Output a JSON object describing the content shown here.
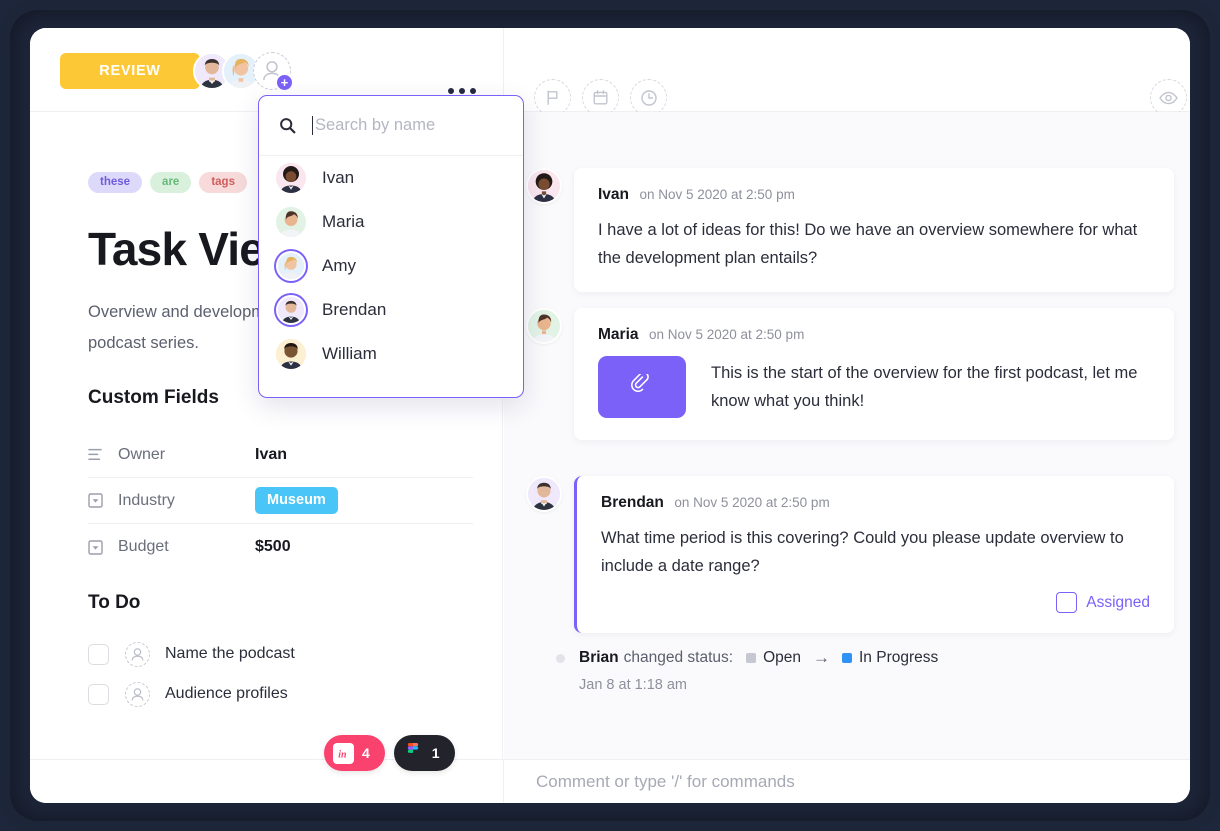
{
  "header": {
    "status_button": "REVIEW",
    "assignee_avatars": [
      "Brendan",
      "Amy"
    ],
    "add_assignee_icon": "add-person-icon",
    "more_icon": "ellipsis-icon",
    "tool_icons": [
      "flag-icon",
      "calendar-icon",
      "clock-icon"
    ],
    "watch_icon": "eye-icon"
  },
  "assignee_dropdown": {
    "search_icon": "search-icon",
    "search_value": "",
    "search_placeholder": "Search by name",
    "people": [
      {
        "name": "Ivan",
        "selected": false,
        "avatar_bg": "#fae6ef"
      },
      {
        "name": "Maria",
        "selected": false,
        "avatar_bg": "#e2f3e6"
      },
      {
        "name": "Amy",
        "selected": true,
        "avatar_bg": "#e4f1fb"
      },
      {
        "name": "Brendan",
        "selected": true,
        "avatar_bg": "#efe9fb"
      },
      {
        "name": "William",
        "selected": false,
        "avatar_bg": "#fcefd2"
      }
    ]
  },
  "task": {
    "tags": [
      {
        "label": "these",
        "bg": "#ddd9fa",
        "color": "#6f5cdb"
      },
      {
        "label": "are",
        "bg": "#d8f0dc",
        "color": "#67b978"
      },
      {
        "label": "tags",
        "bg": "#f7dad9",
        "color": "#cf5c5c"
      }
    ],
    "title": "Task View",
    "description": "Overview and development plan for the original podcast series.",
    "custom_fields_heading": "Custom Fields",
    "fields": [
      {
        "icon": "list-icon",
        "label": "Owner",
        "value": "Ivan",
        "type": "text"
      },
      {
        "icon": "dropdown-icon",
        "label": "Industry",
        "value": "Museum",
        "type": "chip",
        "chip_color": "#49c6f7"
      },
      {
        "icon": "dropdown-icon",
        "label": "Budget",
        "value": "$500",
        "type": "text"
      }
    ],
    "todo_heading": "To Do",
    "todo_items": [
      {
        "label": "Name the podcast",
        "checked": false,
        "assignee_icon": "user-placeholder-icon"
      },
      {
        "label": "Audience profiles",
        "checked": false,
        "assignee_icon": "user-placeholder-icon"
      }
    ]
  },
  "activity": {
    "comments": [
      {
        "author": "Ivan",
        "timestamp": "on Nov 5 2020 at 2:50 pm",
        "body": "I have a lot of ideas for this! Do we have an overview somewhere for what the development plan entails?",
        "has_attachment": false,
        "accent": false,
        "avatar_bg": "#fae6ef"
      },
      {
        "author": "Maria",
        "timestamp": "on Nov 5 2020 at 2:50 pm",
        "body": "This is the start of the overview for the first podcast, let me know what you think!",
        "has_attachment": true,
        "attachment_icon": "paperclip-icon",
        "accent": false,
        "avatar_bg": "#e2f3e6"
      },
      {
        "author": "Brendan",
        "timestamp": "on Nov 5 2020 at 2:50 pm",
        "body": "What time period is this covering? Could you please update overview to include a date range?",
        "has_attachment": false,
        "accent": true,
        "assigned_label": "Assigned",
        "assigned_checked": false,
        "avatar_bg": "#efe9fb"
      }
    ],
    "status_change": {
      "actor": "Brian",
      "action": "changed status:",
      "from_status": "Open",
      "from_color": "#c6c8d1",
      "arrow": "→",
      "to_status": "In Progress",
      "to_color": "#2f93f5",
      "timestamp": "Jan 8 at 1:18 am"
    }
  },
  "footer": {
    "integrations": [
      {
        "name": "InVision",
        "logo": "invision-icon",
        "count": "4",
        "bg": "#f9426e"
      },
      {
        "name": "Figma",
        "logo": "figma-icon",
        "count": "1",
        "bg": "#22232b"
      }
    ],
    "comment_value": "",
    "comment_placeholder": "Comment or type '/' for commands"
  }
}
